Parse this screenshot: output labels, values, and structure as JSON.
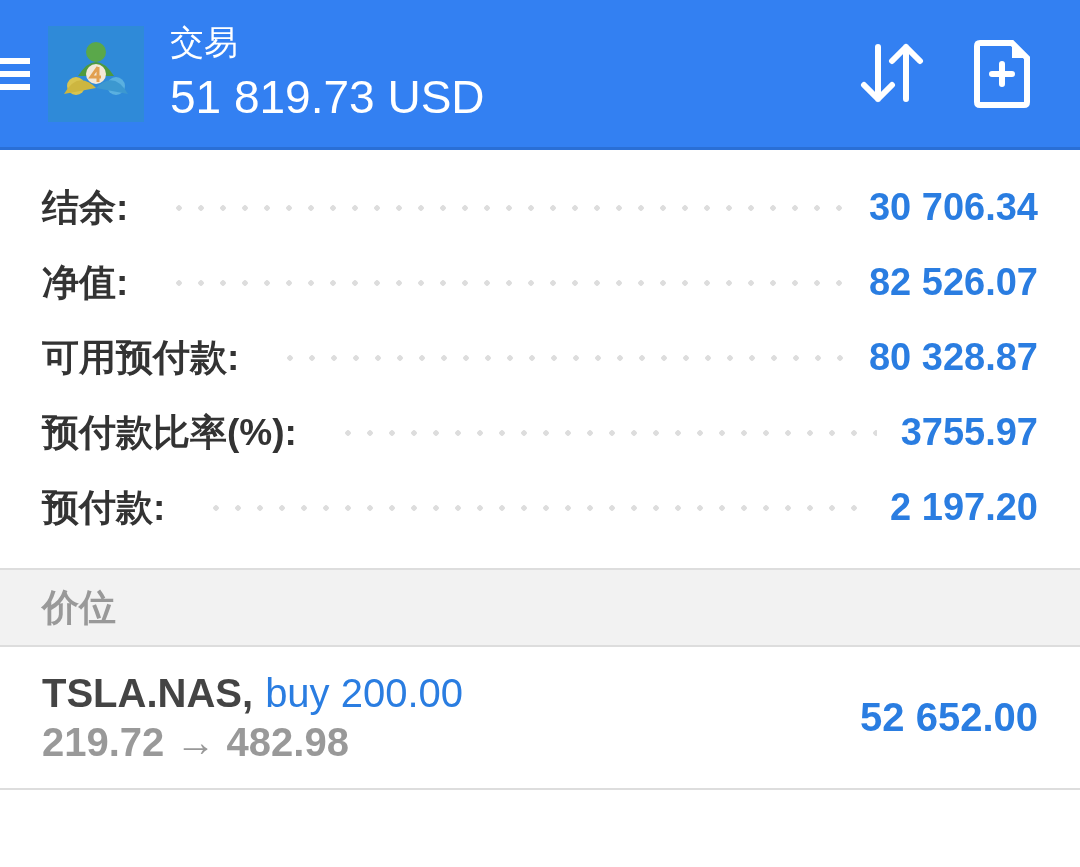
{
  "header": {
    "title": "交易",
    "balance": "51 819.73 USD"
  },
  "account": [
    {
      "label": "结余:",
      "value": "30 706.34"
    },
    {
      "label": "净值:",
      "value": "82 526.07"
    },
    {
      "label": "可用预付款:",
      "value": "80 328.87"
    },
    {
      "label": "预付款比率(%):",
      "value": "3755.97"
    },
    {
      "label": "预付款:",
      "value": "2 197.20"
    }
  ],
  "section": {
    "title": "价位"
  },
  "positions": [
    {
      "symbol": "TSLA.NAS,",
      "order": "buy 200.00",
      "prices": "219.72 → 482.98",
      "profit": "52 652.00"
    }
  ]
}
